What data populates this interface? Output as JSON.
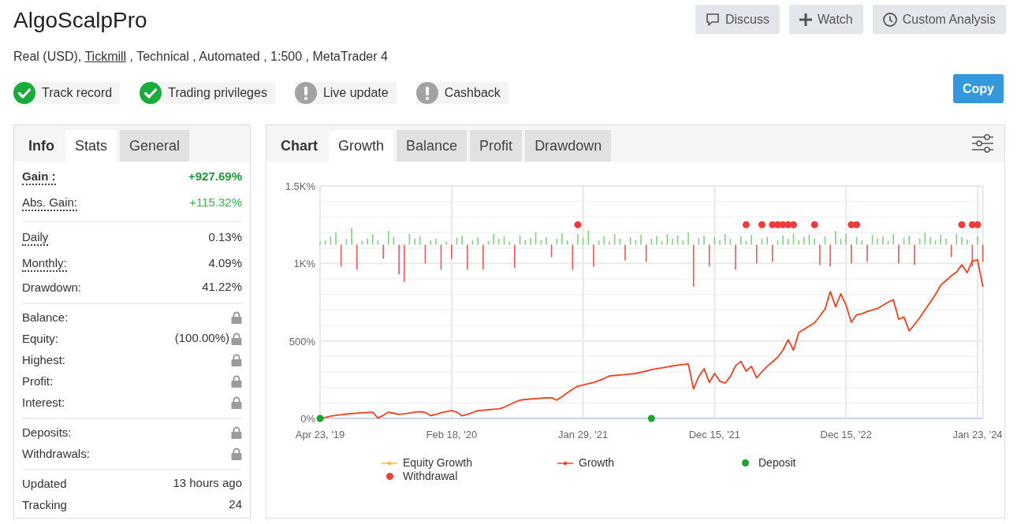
{
  "header": {
    "title": "AlgoScalpPro",
    "details": {
      "before": "Real (USD),",
      "link": "Tickmill",
      "after": ", Technical , Automated , 1:500 , MetaTrader 4"
    },
    "actions": [
      {
        "label": "Discuss",
        "kind": "chat"
      },
      {
        "label": "Watch",
        "kind": "plus"
      },
      {
        "label": "Custom Analysis",
        "kind": "clock"
      }
    ]
  },
  "badges": [
    {
      "label": "Track record",
      "verified": true
    },
    {
      "label": "Trading privileges",
      "verified": true
    },
    {
      "label": "Live update",
      "verified": false
    },
    {
      "label": "Cashback",
      "verified": false
    }
  ],
  "copy_button": "Copy",
  "stats_panel": {
    "heading": "Info",
    "tabs": [
      {
        "label": "Stats",
        "selected": true
      },
      {
        "label": "General",
        "selected": false
      }
    ],
    "groups": [
      {
        "rows": [
          {
            "label": "Gain :",
            "value": "+927.69%",
            "color": "#1e9a3a",
            "hint": true,
            "bold": true,
            "locked": false
          },
          {
            "label": "Abs. Gain:",
            "value": "+115.32%",
            "color": "#3cb54a",
            "hint": true,
            "bold": false,
            "locked": false
          }
        ]
      },
      {
        "rows": [
          {
            "label": "Daily",
            "value": "0.13%",
            "color": "#333333",
            "hint": true,
            "bold": false,
            "locked": false
          },
          {
            "label": "Monthly:",
            "value": "4.09%",
            "color": "#333333",
            "hint": true,
            "bold": false,
            "locked": false
          },
          {
            "label": "Drawdown:",
            "value": "41.22%",
            "color": "#333333",
            "hint": false,
            "bold": false,
            "locked": false
          }
        ]
      },
      {
        "rows": [
          {
            "label": "Balance:",
            "hint": false,
            "bold": false,
            "locked": true
          },
          {
            "label": "Equity:",
            "value": "(100.00%)",
            "color": "#333333",
            "hint": false,
            "bold": false,
            "locked": true
          },
          {
            "label": "Highest:",
            "hint": false,
            "bold": false,
            "locked": true
          },
          {
            "label": "Profit:",
            "hint": false,
            "bold": false,
            "locked": true
          },
          {
            "label": "Interest:",
            "hint": false,
            "bold": false,
            "locked": true
          }
        ]
      },
      {
        "rows": [
          {
            "label": "Deposits:",
            "hint": false,
            "bold": false,
            "locked": true
          },
          {
            "label": "Withdrawals:",
            "hint": false,
            "bold": false,
            "locked": true
          }
        ]
      },
      {
        "rows": [
          {
            "label": "Updated",
            "value": "13 hours ago",
            "color": "#333333",
            "hint": false,
            "bold": false,
            "locked": false
          },
          {
            "label": "Tracking",
            "value": "24",
            "color": "#333333",
            "hint": false,
            "bold": false,
            "locked": false
          }
        ]
      }
    ]
  },
  "chart_panel": {
    "heading": "Chart",
    "tabs": [
      {
        "label": "Growth",
        "selected": true
      },
      {
        "label": "Balance",
        "selected": false
      },
      {
        "label": "Profit",
        "selected": false
      },
      {
        "label": "Drawdown",
        "selected": false
      }
    ],
    "chart_data": {
      "type": "line",
      "grid": true,
      "legend": "bottom",
      "ylim": [
        0,
        1500
      ],
      "yticks": [
        {
          "value": 0,
          "label": "0%"
        },
        {
          "value": 500,
          "label": "500%"
        },
        {
          "value": 1000,
          "label": "1K%"
        },
        {
          "value": 1500,
          "label": "1.5K%"
        }
      ],
      "categories": [
        "Apr 23, '19",
        null,
        null,
        null,
        null,
        null,
        null,
        null,
        null,
        null,
        null,
        null,
        null,
        null,
        null,
        null,
        null,
        null,
        null,
        null,
        null,
        null,
        null,
        null,
        null,
        "Feb 18, '20",
        null,
        null,
        null,
        null,
        null,
        null,
        null,
        null,
        null,
        null,
        null,
        null,
        null,
        null,
        null,
        null,
        null,
        null,
        null,
        null,
        null,
        null,
        null,
        null,
        "Jan 29, '21",
        null,
        null,
        null,
        null,
        null,
        null,
        null,
        null,
        null,
        null,
        null,
        null,
        null,
        null,
        null,
        null,
        null,
        null,
        null,
        null,
        null,
        null,
        null,
        null,
        "Dec 15, '21",
        null,
        null,
        null,
        null,
        null,
        null,
        null,
        null,
        null,
        null,
        null,
        null,
        null,
        null,
        null,
        null,
        null,
        null,
        null,
        null,
        null,
        null,
        null,
        null,
        "Dec 15, '22",
        null,
        null,
        null,
        null,
        null,
        null,
        null,
        null,
        null,
        null,
        null,
        null,
        null,
        null,
        null,
        null,
        null,
        null,
        null,
        null,
        null,
        null,
        null,
        null,
        "Jan 23, '24",
        null
      ],
      "series": [
        {
          "name": "Equity Growth",
          "type": "line",
          "color": "#f5c02a",
          "values": [
            null,
            null,
            null,
            null,
            null,
            null,
            null,
            null,
            null,
            null,
            null,
            null,
            null,
            null,
            null,
            null,
            null,
            null,
            null,
            null,
            null,
            null,
            null,
            null,
            null,
            null,
            null,
            null,
            null,
            null,
            null,
            null,
            null,
            null,
            null,
            null,
            null,
            null,
            null,
            null,
            null,
            null,
            null,
            null,
            null,
            null,
            null,
            null,
            null,
            null,
            null,
            null,
            null,
            null,
            null,
            null,
            null,
            null,
            null,
            null,
            null,
            null,
            null,
            null,
            null,
            null,
            null,
            null,
            null,
            null,
            null,
            null,
            null,
            null,
            null,
            null,
            null,
            null,
            null,
            null,
            null,
            null,
            null,
            null,
            null,
            null,
            null,
            null,
            null,
            null,
            null,
            null,
            null,
            null,
            null,
            null,
            null,
            null,
            null,
            null,
            null,
            null,
            null,
            null,
            null,
            null,
            null,
            null,
            null,
            null,
            null,
            null,
            null,
            null,
            null,
            null,
            null,
            null,
            null,
            null,
            null,
            null,
            null,
            null,
            null,
            null,
            null
          ]
        },
        {
          "name": "Growth",
          "type": "line",
          "color": "#f0401e",
          "values": [
            0,
            6,
            14,
            20,
            24,
            28,
            31,
            34,
            36,
            38,
            40,
            2,
            20,
            40,
            33,
            26,
            30,
            35,
            40,
            44,
            38,
            18,
            26,
            36,
            44,
            50,
            40,
            17,
            26,
            38,
            50,
            53,
            56,
            59,
            62,
            72,
            88,
            104,
            118,
            122,
            125,
            128,
            130,
            132,
            134,
            118,
            140,
            165,
            188,
            208,
            215,
            224,
            232,
            243,
            258,
            274,
            277,
            280,
            283,
            287,
            290,
            298,
            306,
            314,
            321,
            326,
            332,
            338,
            344,
            348,
            352,
            190,
            270,
            321,
            232,
            290,
            240,
            228,
            270,
            340,
            368,
            305,
            336,
            262,
            300,
            336,
            365,
            395,
            440,
            508,
            440,
            554,
            575,
            596,
            617,
            660,
            705,
            819,
            720,
            804,
            730,
            620,
            668,
            676,
            690,
            700,
            710,
            730,
            750,
            766,
            640,
            654,
            565,
            605,
            650,
            700,
            750,
            800,
            860,
            890,
            920,
            945,
            991,
            940,
            1016,
            1022,
            850
          ]
        },
        {
          "name": "Deposit",
          "type": "scatter",
          "color": "#18a534",
          "values": [
            0,
            null,
            null,
            null,
            null,
            null,
            null,
            null,
            null,
            null,
            null,
            null,
            null,
            null,
            null,
            null,
            null,
            null,
            null,
            null,
            null,
            null,
            null,
            null,
            null,
            null,
            null,
            null,
            null,
            null,
            null,
            null,
            null,
            null,
            null,
            null,
            null,
            null,
            null,
            null,
            null,
            null,
            null,
            null,
            null,
            null,
            null,
            null,
            null,
            null,
            null,
            null,
            null,
            null,
            null,
            null,
            null,
            null,
            null,
            null,
            null,
            null,
            null,
            0,
            null,
            null,
            null,
            null,
            null,
            null,
            null,
            null,
            null,
            null,
            null,
            null,
            null,
            null,
            null,
            null,
            null,
            null,
            null,
            null,
            null,
            null,
            null,
            null,
            null,
            null,
            null,
            null,
            null,
            null,
            null,
            null,
            null,
            null,
            null,
            null,
            null,
            null,
            null,
            null,
            null,
            null,
            null,
            null,
            null,
            null,
            null,
            null,
            null,
            null,
            null,
            null,
            null,
            null,
            null,
            null,
            null,
            null,
            null,
            null,
            null,
            null,
            null
          ]
        },
        {
          "name": "Withdrawal",
          "type": "scatter",
          "color": "#ee3b3b",
          "values": [
            null,
            null,
            null,
            null,
            null,
            null,
            null,
            null,
            null,
            null,
            null,
            null,
            null,
            null,
            null,
            null,
            null,
            null,
            null,
            null,
            null,
            null,
            null,
            null,
            null,
            null,
            null,
            null,
            null,
            null,
            null,
            null,
            null,
            null,
            null,
            null,
            null,
            null,
            null,
            null,
            null,
            null,
            null,
            null,
            null,
            null,
            null,
            null,
            null,
            1250,
            null,
            null,
            null,
            null,
            null,
            null,
            null,
            null,
            null,
            null,
            null,
            null,
            null,
            null,
            null,
            null,
            null,
            null,
            null,
            null,
            null,
            null,
            null,
            null,
            null,
            null,
            null,
            null,
            null,
            null,
            null,
            1250,
            null,
            null,
            1250,
            null,
            1250,
            1250,
            1250,
            1250,
            1250,
            null,
            null,
            null,
            1250,
            null,
            null,
            null,
            null,
            null,
            null,
            1250,
            1250,
            null,
            null,
            null,
            null,
            null,
            null,
            null,
            null,
            null,
            null,
            null,
            null,
            null,
            null,
            null,
            null,
            null,
            null,
            null,
            1250,
            null,
            1250,
            1250,
            null
          ]
        },
        {
          "type": "bar",
          "base": [
            1121,
            1121,
            1121,
            1121,
            1121,
            1121,
            1121,
            1121,
            1121,
            1121,
            1121,
            1121,
            1121,
            1121,
            1121,
            1121,
            1121,
            1121,
            1121,
            1121,
            1121,
            1121,
            1121,
            1121,
            1121,
            1121,
            1121,
            1121,
            1121,
            1121,
            1121,
            1121,
            1121,
            1121,
            1121,
            1121,
            1121,
            1121,
            1121,
            1121,
            1121,
            1121,
            1121,
            1121,
            1121,
            1121,
            1121,
            1121,
            1121,
            1121,
            1121,
            1121,
            1121,
            1121,
            1121,
            1121,
            1121,
            1121,
            1121,
            1121,
            1121,
            1121,
            1121,
            1121,
            1121,
            1121,
            1121,
            1121,
            1121,
            1121,
            1121,
            1121,
            1121,
            1121,
            1121,
            1121,
            1121,
            1121,
            1121,
            1121,
            1121,
            1121,
            1121,
            1121,
            1121,
            1121,
            1121,
            1121,
            1121,
            1121,
            1121,
            1121,
            1121,
            1121,
            1121,
            1121,
            1121,
            1121,
            1121,
            1121,
            1121,
            1121,
            1121,
            1121,
            1121,
            1121,
            1121,
            1121,
            1121,
            1121,
            1121,
            1121,
            1121,
            1121,
            1121,
            1121,
            1121,
            1121,
            1121,
            1121,
            1121,
            1121,
            1121,
            1121,
            1121,
            1121,
            1121
          ],
          "values": [
            19,
            29,
            54,
            79,
            -141,
            39,
            109,
            -161,
            24,
            39,
            69,
            29,
            -91,
            89,
            49,
            -191,
            -241,
            69,
            39,
            54,
            -121,
            29,
            39,
            -161,
            19,
            -91,
            44,
            59,
            -161,
            29,
            49,
            -161,
            24,
            69,
            39,
            54,
            19,
            -151,
            59,
            29,
            44,
            79,
            29,
            49,
            -81,
            39,
            74,
            29,
            -161,
            69,
            44,
            89,
            -141,
            29,
            54,
            19,
            69,
            39,
            -101,
            49,
            29,
            64,
            -111,
            39,
            54,
            24,
            69,
            39,
            59,
            29,
            79,
            -271,
            44,
            59,
            -141,
            49,
            29,
            69,
            39,
            -161,
            54,
            24,
            64,
            -121,
            39,
            49,
            -111,
            29,
            59,
            39,
            74,
            29,
            49,
            64,
            39,
            -131,
            54,
            -141,
            89,
            39,
            69,
            -121,
            49,
            29,
            -111,
            64,
            39,
            54,
            24,
            69,
            -121,
            44,
            59,
            -131,
            39,
            79,
            49,
            29,
            64,
            39,
            -81,
            69,
            49,
            34,
            -141,
            54,
            -111
          ],
          "colors": [
            "#84cf84",
            "#84cf84",
            "#84cf84",
            "#84cf84",
            "#f05555",
            "#84cf84",
            "#84cf84",
            "#f05555",
            "#84cf84",
            "#84cf84",
            "#84cf84",
            "#84cf84",
            "#f05555",
            "#84cf84",
            "#84cf84",
            "#f05555",
            "#f05555",
            "#84cf84",
            "#84cf84",
            "#84cf84",
            "#f05555",
            "#84cf84",
            "#84cf84",
            "#f05555",
            "#84cf84",
            "#f05555",
            "#84cf84",
            "#84cf84",
            "#f05555",
            "#84cf84",
            "#84cf84",
            "#f05555",
            "#84cf84",
            "#84cf84",
            "#84cf84",
            "#84cf84",
            "#84cf84",
            "#f05555",
            "#84cf84",
            "#84cf84",
            "#84cf84",
            "#84cf84",
            "#84cf84",
            "#84cf84",
            "#f05555",
            "#84cf84",
            "#84cf84",
            "#84cf84",
            "#f05555",
            "#84cf84",
            "#84cf84",
            "#84cf84",
            "#f05555",
            "#84cf84",
            "#84cf84",
            "#84cf84",
            "#84cf84",
            "#84cf84",
            "#f05555",
            "#84cf84",
            "#84cf84",
            "#84cf84",
            "#f05555",
            "#84cf84",
            "#84cf84",
            "#84cf84",
            "#84cf84",
            "#84cf84",
            "#84cf84",
            "#84cf84",
            "#84cf84",
            "#f05555",
            "#84cf84",
            "#84cf84",
            "#f05555",
            "#84cf84",
            "#84cf84",
            "#84cf84",
            "#84cf84",
            "#f05555",
            "#84cf84",
            "#84cf84",
            "#84cf84",
            "#f05555",
            "#84cf84",
            "#84cf84",
            "#f05555",
            "#84cf84",
            "#84cf84",
            "#84cf84",
            "#84cf84",
            "#84cf84",
            "#84cf84",
            "#84cf84",
            "#84cf84",
            "#f05555",
            "#84cf84",
            "#f05555",
            "#84cf84",
            "#84cf84",
            "#84cf84",
            "#f05555",
            "#84cf84",
            "#84cf84",
            "#f05555",
            "#84cf84",
            "#84cf84",
            "#84cf84",
            "#84cf84",
            "#84cf84",
            "#f05555",
            "#84cf84",
            "#84cf84",
            "#f05555",
            "#84cf84",
            "#84cf84",
            "#84cf84",
            "#84cf84",
            "#84cf84",
            "#84cf84",
            "#f05555",
            "#84cf84",
            "#84cf84",
            "#84cf84",
            "#f05555",
            "#84cf84",
            "#f05555"
          ]
        }
      ]
    }
  }
}
